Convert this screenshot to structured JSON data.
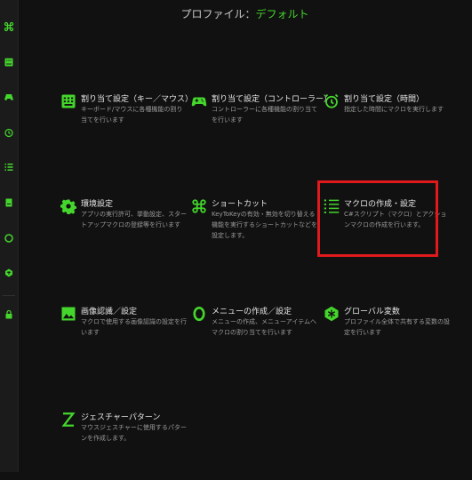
{
  "colors": {
    "accent": "#44d62c",
    "highlight": "#e0191c",
    "background": "#111111"
  },
  "header": {
    "label": "プロファイル：",
    "value": "デフォルト"
  },
  "sidebar": {
    "icons": [
      "command-icon",
      "keyboard-icon",
      "gamepad-icon",
      "alarm-icon",
      "list-icon",
      "book-icon",
      "circle-icon",
      "brain-icon",
      "lock-icon"
    ]
  },
  "tiles": [
    {
      "icon": "keyboard-icon",
      "title": "割り当て設定（キー／マウス）",
      "desc": "キーボード/マウスに各種機能の割り当てを行います"
    },
    {
      "icon": "gamepad-icon",
      "title": "割り当て設定（コントローラー）",
      "desc": "コントローラーに各種機能の割り当てを行います"
    },
    {
      "icon": "alarm-icon",
      "title": "割り当て設定（時間）",
      "desc": "指定した時間にマクロを実行します"
    },
    {
      "icon": "gear-icon",
      "title": "環境設定",
      "desc": "アプリの実行許可、挙動設定、スタートアップマクロの登録等を行います"
    },
    {
      "icon": "command-icon",
      "title": "ショートカット",
      "desc": "KeyToKeyの有効・無効を切り替える機能を実行するショートカットなどを設定します。"
    },
    {
      "icon": "macro-list-icon",
      "title": "マクロの作成・設定",
      "desc": "C#スクリプト（マクロ）とアクションマクロの作成を行います。"
    },
    {
      "icon": "image-icon",
      "title": "画像認識／設定",
      "desc": "マクロで使用する画像認識の設定を行います"
    },
    {
      "icon": "ring-icon",
      "title": "メニューの作成／設定",
      "desc": "メニューの作成、メニューアイテムへマクロの割り当てを行います"
    },
    {
      "icon": "brain-icon",
      "title": "グローバル変数",
      "desc": "プロファイル全体で共有する変数の設定を行います"
    },
    {
      "icon": "gesture-z-icon",
      "title": "ジェスチャーパターン",
      "desc": "マウスジェスチャーに使用するパターンを作成します。"
    }
  ]
}
